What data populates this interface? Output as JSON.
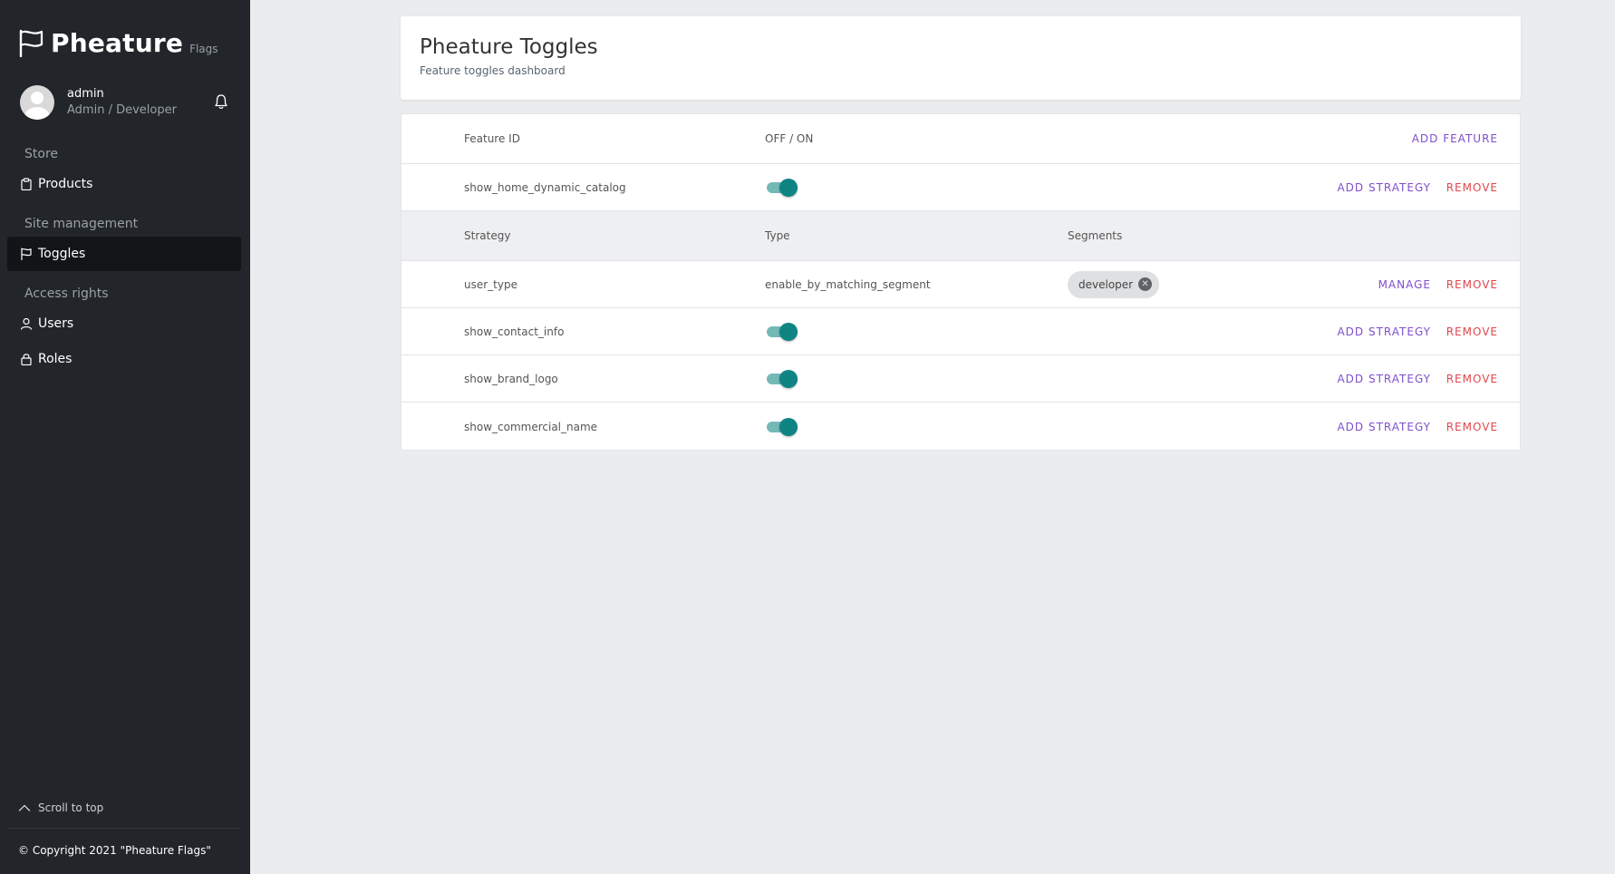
{
  "brand": {
    "name": "Pheature",
    "sub": "Flags"
  },
  "user": {
    "name": "admin",
    "role": "Admin / Developer"
  },
  "nav": {
    "sections": [
      {
        "title": "Store",
        "items": [
          {
            "label": "Products"
          }
        ]
      },
      {
        "title": "Site management",
        "items": [
          {
            "label": "Toggles"
          }
        ]
      },
      {
        "title": "Access rights",
        "items": [
          {
            "label": "Users"
          },
          {
            "label": "Roles"
          }
        ]
      }
    ]
  },
  "footer": {
    "scroll_to_top": "Scroll to top",
    "copyright": "© Copyright 2021 \"Pheature Flags\""
  },
  "header": {
    "title": "Pheature Toggles",
    "subtitle": "Feature toggles dashboard"
  },
  "table": {
    "columns": {
      "feature_id": "Feature ID",
      "toggle": "OFF / ON"
    },
    "add_feature_label": "ADD FEATURE",
    "add_strategy_label": "ADD STRATEGY",
    "remove_label": "REMOVE",
    "manage_label": "MANAGE",
    "strategy_columns": {
      "strategy": "Strategy",
      "type": "Type",
      "segments": "Segments"
    },
    "features": [
      {
        "id": "show_home_dynamic_catalog",
        "enabled": true
      },
      {
        "id": "show_contact_info",
        "enabled": true
      },
      {
        "id": "show_brand_logo",
        "enabled": true
      },
      {
        "id": "show_commercial_name",
        "enabled": true
      }
    ],
    "strategies": [
      {
        "strategy": "user_type",
        "type": "enable_by_matching_segment",
        "segments": [
          "developer"
        ]
      }
    ]
  },
  "colors": {
    "sidebar": "#22262b",
    "accent_purple": "#7f4fcb",
    "accent_red": "#e0464d",
    "toggle_on": "#0f8483"
  }
}
